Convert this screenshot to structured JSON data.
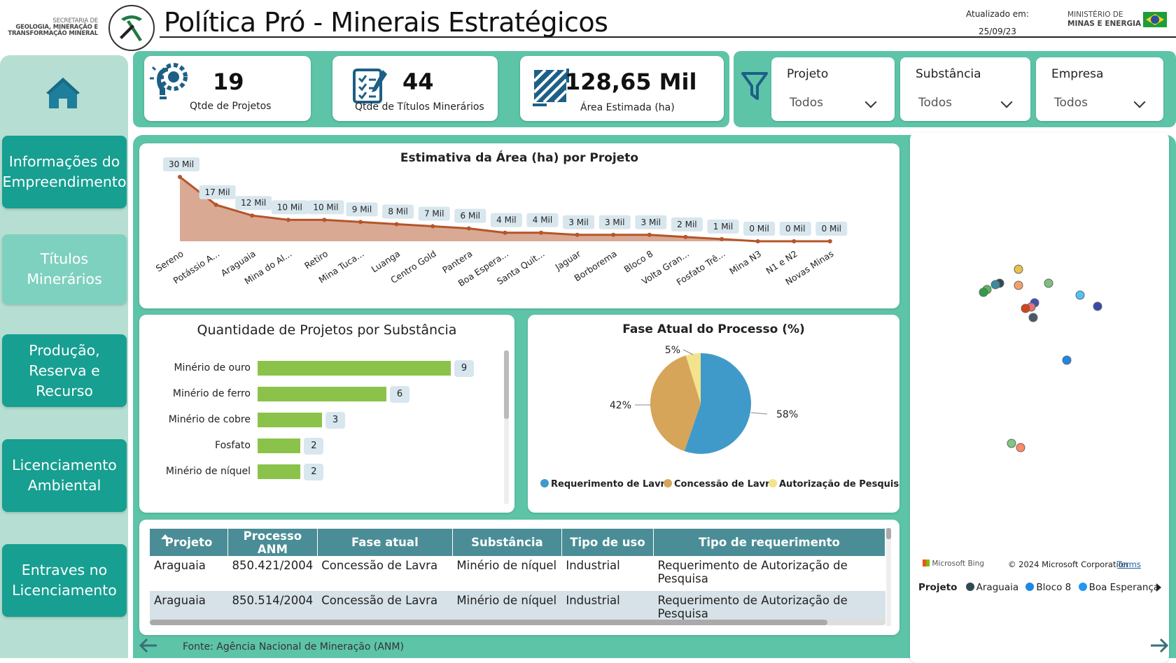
{
  "header": {
    "secretaria_lines": [
      "SECRETARIA DE",
      "GEOLOGIA, MINERAÇÃO E",
      "TRANSFORMAÇÃO MINERAL"
    ],
    "title": "Política Pró - Minerais Estratégicos",
    "updated_label": "Atualizado em:",
    "updated_date": "25/09/23",
    "ministry_line1": "MINISTÉRIO DE",
    "ministry_line2": "MINAS E ENERGIA"
  },
  "nav": {
    "items": [
      {
        "label_lines": [
          "Informações do",
          "Empreendimento"
        ],
        "active": false
      },
      {
        "label_lines": [
          "Títulos",
          "Minerários"
        ],
        "active": true
      },
      {
        "label_lines": [
          "Produção,",
          "Reserva e",
          "Recurso"
        ],
        "active": false
      },
      {
        "label_lines": [
          "Licenciamento",
          "Ambiental"
        ],
        "active": false
      },
      {
        "label_lines": [
          "Entraves no",
          "Licenciamento"
        ],
        "active": false
      }
    ]
  },
  "kpis": {
    "projetos": {
      "value": "19",
      "label": "Qtde de Projetos"
    },
    "titulos": {
      "value": "44",
      "label": "Qtde de Títulos Minerários"
    },
    "area": {
      "value": "128,65 Mil",
      "label": "Área Estimada (ha)"
    }
  },
  "filters": [
    {
      "title": "Projeto",
      "value": "Todos"
    },
    {
      "title": "Substância",
      "value": "Todos"
    },
    {
      "title": "Empresa",
      "value": "Todos"
    }
  ],
  "chart_data": [
    {
      "type": "area",
      "title": "Estimativa da Área (ha) por Projeto",
      "categories": [
        "Sereno",
        "Potássio A...",
        "Araguaia",
        "Mina do Al...",
        "Retiro",
        "Mina Tuca...",
        "Luanga",
        "Centro Gold",
        "Pantera",
        "Boa Espera...",
        "Santa Quit...",
        "Jaguar",
        "Borborema",
        "Bloco 8",
        "Volta Gran...",
        "Fosfato Trê...",
        "Mina N3",
        "N1 e N2",
        "Novas Minas"
      ],
      "values": [
        30,
        17,
        12,
        10,
        10,
        9,
        8,
        7,
        6,
        4,
        4,
        3,
        3,
        3,
        2,
        1,
        0,
        0,
        0
      ],
      "data_labels": [
        "30 Mil",
        "17 Mil",
        "12 Mil",
        "10 Mil",
        "10 Mil",
        "9 Mil",
        "8 Mil",
        "7 Mil",
        "6 Mil",
        "4 Mil",
        "4 Mil",
        "3 Mil",
        "3 Mil",
        "3 Mil",
        "2 Mil",
        "1 Mil",
        "0 Mil",
        "0 Mil",
        "0 Mil"
      ],
      "unit": "Mil ha",
      "colors": {
        "line": "#b5552a",
        "fill": "#d9a994"
      }
    },
    {
      "type": "bar",
      "title": "Quantidade de Projetos por Substância",
      "categories": [
        "Minério de ouro",
        "Minério de ferro",
        "Minério de cobre",
        "Fosfato",
        "Minério de níquel"
      ],
      "values": [
        9,
        6,
        3,
        2,
        2
      ],
      "colors": {
        "bar": "#8bc34a"
      }
    },
    {
      "type": "pie",
      "title": "Fase Atual do Processo (%)",
      "categories": [
        "Requerimento de Lavra",
        "Concessão de Lavra",
        "Autorização de Pesquisa"
      ],
      "values": [
        58,
        42,
        5
      ],
      "data_labels": [
        "58%",
        "42%",
        "5%"
      ],
      "colors": [
        "#3f9ac9",
        "#d6a55a",
        "#f2e38c"
      ]
    }
  ],
  "table": {
    "columns": [
      "Projeto",
      "Processo ANM",
      "Fase atual",
      "Substância",
      "Tipo de uso",
      "Tipo de requerimento"
    ],
    "rows": [
      [
        "Araguaia",
        "850.421/2004",
        "Concessão de Lavra",
        "Minério de níquel",
        "Industrial",
        "Requerimento de Autorização de Pesquisa"
      ],
      [
        "Araguaia",
        "850.514/2004",
        "Concessão de Lavra",
        "Minério de níquel",
        "Industrial",
        "Requerimento de Autorização de Pesquisa"
      ]
    ]
  },
  "map": {
    "attribution_brand": "Microsoft Bing",
    "attribution": "© 2024 Microsoft Corporation",
    "terms": "Terms",
    "legend_title": "Projeto",
    "legend_items": [
      {
        "name": "Araguaia",
        "color": "#2f4a55"
      },
      {
        "name": "Bloco 8",
        "color": "#1e88e5"
      },
      {
        "name": "Boa Esperança",
        "color": "#2196f3"
      }
    ]
  },
  "footer": {
    "source": "Fonte: Agência Nacional de Mineração (ANM)"
  },
  "colors": {
    "teal": "#179f91",
    "teal_light": "#5dc4a8",
    "nav_bg": "#b7ded2",
    "active_nav": "#7fd1bf",
    "table_header": "#4a8d96"
  }
}
